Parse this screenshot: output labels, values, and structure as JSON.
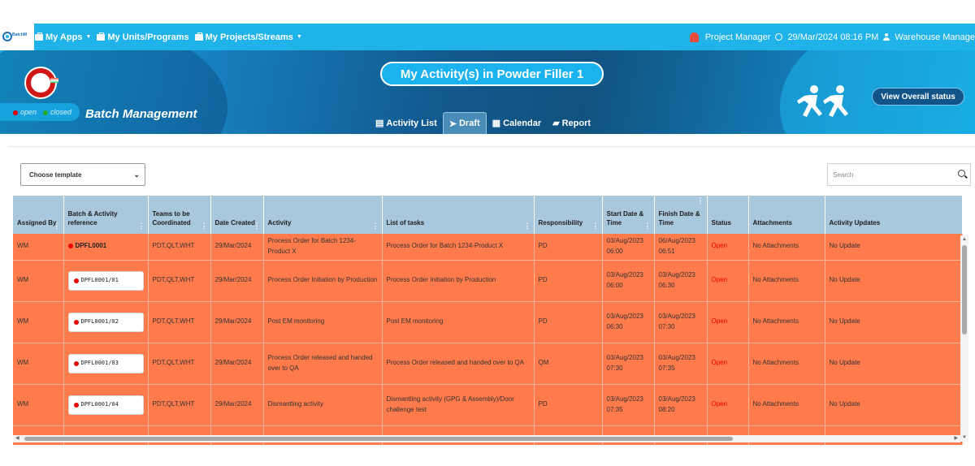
{
  "topbar": {
    "logo_text": "BatchM",
    "nav": [
      {
        "label": "My Apps"
      },
      {
        "label": "My Units/Programs"
      },
      {
        "label": "My Projects/Streams"
      }
    ],
    "role": "Project Manager",
    "datetime": "29/Mar/2024 08:16 PM",
    "user": "Warehouse Manage"
  },
  "banner": {
    "legend_open": "open",
    "legend_closed": "closed",
    "app_title": "Batch Management",
    "page_title": "My Activity(s) in Powder Filler 1",
    "tabs": [
      {
        "label": "Activity List",
        "icon": "list-icon"
      },
      {
        "label": "Draft",
        "icon": "paper-plane-icon"
      },
      {
        "label": "Calendar",
        "icon": "calendar-icon"
      },
      {
        "label": "Report",
        "icon": "book-icon"
      }
    ],
    "overall_button": "View Overall status"
  },
  "filters": {
    "template_select": "Choose template",
    "search_placeholder": "Search"
  },
  "table": {
    "headers": [
      "Assigned By",
      "Batch & Activity reference",
      "Teams to be Coordinated",
      "Date Created",
      "Activity",
      "List of tasks",
      "Responsibility",
      "Start Date & Time",
      "Finish Date & Time",
      "Status",
      "Attachments",
      "Activity Updates"
    ],
    "rows": [
      {
        "assigned": "WM",
        "ref": "DPFL0001",
        "teams": "PDT,QLT,WHT",
        "date": "29/Mar/2024",
        "activity": "Process Order for Batch 1234-Product X",
        "tasks": "Process Order for Batch 1234-Product X",
        "resp": "PD",
        "start": "03/Aug/2023 06:00",
        "finish": "06/Aug/2023 06:51",
        "status": "Open",
        "attach": "No Attachments",
        "updates": "No Update"
      },
      {
        "assigned": "WM",
        "ref": "DPFL0001/01",
        "teams": "PDT,QLT,WHT",
        "date": "29/Mar/2024",
        "activity": "Process Order Initiation by Production",
        "tasks": "Process Order Initiation by Production",
        "resp": "PD",
        "start": "03/Aug/2023 06:00",
        "finish": "03/Aug/2023 06:30",
        "status": "Open",
        "attach": "No Attachments",
        "updates": "No Update"
      },
      {
        "assigned": "WM",
        "ref": "DPFL0001/02",
        "teams": "PDT,QLT,WHT",
        "date": "29/Mar/2024",
        "activity": "Post EM monitoring",
        "tasks": "Post EM monitoring",
        "resp": "PD",
        "start": "03/Aug/2023 06:30",
        "finish": "03/Aug/2023 07:30",
        "status": "Open",
        "attach": "No Attachments",
        "updates": "No Update"
      },
      {
        "assigned": "WM",
        "ref": "DPFL0001/03",
        "teams": "PDT,QLT,WHT",
        "date": "29/Mar/2024",
        "activity": "Process Order released and handed over to QA",
        "tasks": "Process Order released and handed over to QA",
        "resp": "QM",
        "start": "03/Aug/2023 07:30",
        "finish": "03/Aug/2023 07:35",
        "status": "Open",
        "attach": "No Attachments",
        "updates": "No Update"
      },
      {
        "assigned": "WM",
        "ref": "DPFL0001/04",
        "teams": "PDT,QLT,WHT",
        "date": "29/Mar/2024",
        "activity": "Dismantling  activity",
        "tasks": "Dismantling  activity (GPG & Assembly)/Door challenge test",
        "resp": "PD",
        "start": "03/Aug/2023 07:35",
        "finish": "03/Aug/2023 08:20",
        "status": "Open",
        "attach": "No Attachments",
        "updates": "No Update"
      }
    ]
  },
  "colors": {
    "topbar": "#1fb3ea",
    "row_bg": "#ff7b4c",
    "header_bg": "#a9c7dd",
    "open_dot": "#e00000",
    "closed_dot": "#22aa22"
  }
}
